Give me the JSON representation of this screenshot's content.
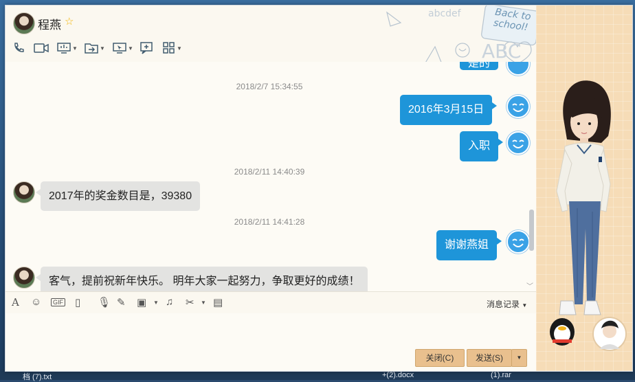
{
  "window": {
    "contact_name": "程燕",
    "controls": {
      "minimize": "–",
      "maximize": "□",
      "close": "✕"
    }
  },
  "header_decoration": {
    "back_to_school": "Back to school!",
    "abc": "ABC",
    "abcdef": "abcdef"
  },
  "messages": [
    {
      "type": "partial_right",
      "text": "是的"
    },
    {
      "type": "timestamp",
      "text": "2018/2/7 15:34:55"
    },
    {
      "type": "right",
      "text": "2016年3月15日"
    },
    {
      "type": "right",
      "text": "入职"
    },
    {
      "type": "timestamp",
      "text": "2018/2/11 14:40:39"
    },
    {
      "type": "left",
      "text": "2017年的奖金数目是，39380"
    },
    {
      "type": "timestamp",
      "text": "2018/2/11 14:41:28"
    },
    {
      "type": "right",
      "text": "谢谢燕姐"
    },
    {
      "type": "left",
      "text": "客气，提前祝新年快乐。 明年大家一起努力，争取更好的成绩！"
    }
  ],
  "input_toolbar": {
    "history_label": "消息记录"
  },
  "buttons": {
    "close": "关闭(C)",
    "send": "发送(S)"
  },
  "taskbar": {
    "item1": "档 (7).txt",
    "item2": "+(2).docx",
    "item3": "(1).rar"
  },
  "colors": {
    "bubble_sent": "#1e95d9",
    "bubble_received": "#e3e3e1",
    "button": "#e9c08e"
  }
}
